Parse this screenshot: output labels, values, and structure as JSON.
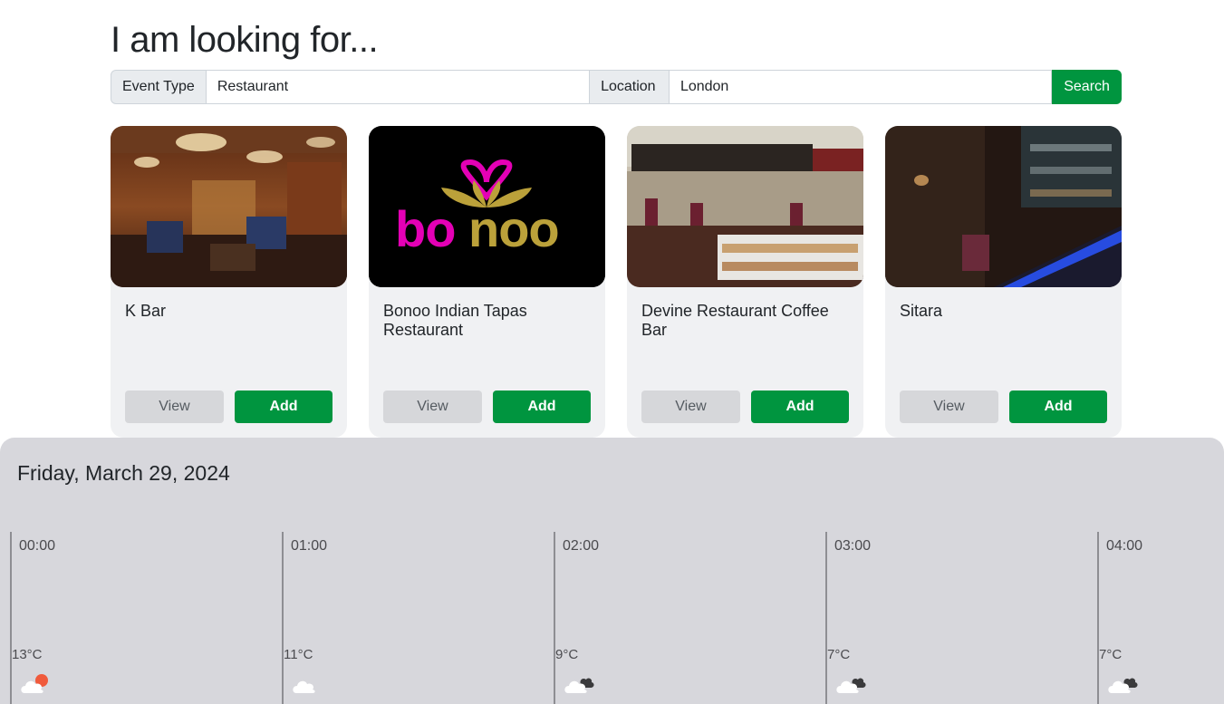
{
  "header": {
    "title": "I am looking for..."
  },
  "search": {
    "event_type_label": "Event Type",
    "event_type_value": "Restaurant",
    "location_label": "Location",
    "location_value": "London",
    "search_label": "Search"
  },
  "cards": [
    {
      "title": "K Bar",
      "view_label": "View",
      "add_label": "Add",
      "image": "luxury-bar-interior-photo"
    },
    {
      "title": "Bonoo Indian Tapas Restaurant",
      "view_label": "View",
      "add_label": "Add",
      "image": "bonoo-logo",
      "logo_text": "bonoo"
    },
    {
      "title": "Devine Restaurant Coffee Bar",
      "view_label": "View",
      "add_label": "Add",
      "image": "coffee-bar-counter-photo"
    },
    {
      "title": "Sitara",
      "view_label": "View",
      "add_label": "Add",
      "image": "dark-bar-interior-photo"
    }
  ],
  "weather": {
    "date": "Friday, March 29, 2024",
    "hours": [
      {
        "time": "00:00",
        "temp": "13°C",
        "icon": "cloud-sun-icon"
      },
      {
        "time": "01:00",
        "temp": "11°C",
        "icon": "cloud-icon"
      },
      {
        "time": "02:00",
        "temp": "9°C",
        "icon": "cloud-dark-icon"
      },
      {
        "time": "03:00",
        "temp": "7°C",
        "icon": "cloud-dark-icon"
      },
      {
        "time": "04:00",
        "temp": "7°C",
        "icon": "cloud-dark-icon"
      }
    ]
  },
  "colors": {
    "accent": "#00953f",
    "card_bg": "#f0f1f3",
    "weather_bg": "#d7d7dc"
  }
}
